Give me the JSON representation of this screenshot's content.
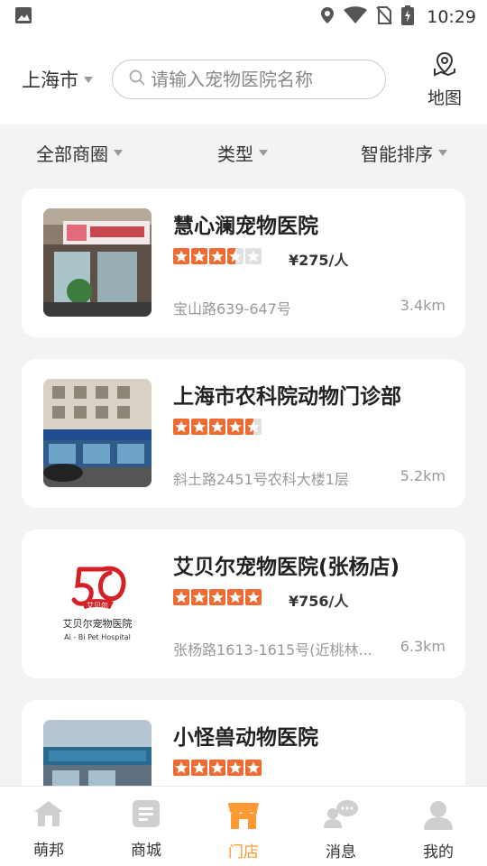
{
  "status_bar": {
    "time": "10:29"
  },
  "header": {
    "city": "上海市",
    "search_placeholder": "请输入宠物医院名称",
    "map_label": "地图"
  },
  "filters": [
    "全部商圈",
    "类型",
    "智能排序"
  ],
  "hospitals": [
    {
      "name": "慧心澜宠物医院",
      "rating": 3.5,
      "price": "¥275/人",
      "address": "宝山路639-647号",
      "distance": "3.4km"
    },
    {
      "name": "上海市农科院动物门诊部",
      "rating": 4.5,
      "price": "",
      "address": "斜土路2451号农科大楼1层",
      "distance": "5.2km"
    },
    {
      "name": "艾贝尔宠物医院(张杨店)",
      "rating": 5,
      "price": "¥756/人",
      "address": "张杨路1613-1615号(近桃林...",
      "distance": "6.3km",
      "logo_text_cn": "艾贝尔宠物医院",
      "logo_text_en": "Ai - Bi Pet Hospital",
      "logo_badge": "艾贝尔"
    },
    {
      "name": "小怪兽动物医院",
      "rating": 5,
      "price": "",
      "address": "",
      "distance": ""
    }
  ],
  "tabbar": [
    {
      "label": "萌邦",
      "icon": "house-icon",
      "active": false
    },
    {
      "label": "商城",
      "icon": "list-icon",
      "active": false
    },
    {
      "label": "门店",
      "icon": "store-icon",
      "active": true
    },
    {
      "label": "消息",
      "icon": "chat-icon",
      "active": false
    },
    {
      "label": "我的",
      "icon": "user-icon",
      "active": false
    }
  ],
  "colors": {
    "accent": "#ff9933",
    "star": "#ee6c34",
    "muted": "#999999"
  }
}
